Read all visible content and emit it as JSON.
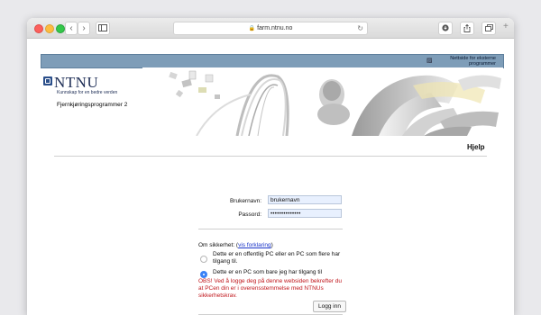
{
  "browser": {
    "url": "farm.ntnu.no",
    "back_glyph": "‹",
    "forward_glyph": "›",
    "new_tab_glyph": "+"
  },
  "header": {
    "external_link": "Nettside for eksterne programmer",
    "logo_text": "NTNU",
    "logo_tagline": "Kunnskap for en bedre verden",
    "system_name": "Fjernkjøringsprogrammer 2",
    "help": "Hjelp"
  },
  "login": {
    "username_label": "Brukernavn:",
    "username_value": "brukernavn",
    "password_label": "Passord:",
    "password_value": "••••••••••••••",
    "security_label": "Om sikkerhet:",
    "security_link": "vis forklaring",
    "option_public": "Dette er en offentlig PC eller en PC som flere har tilgang til.",
    "option_private": "Dette er en PC som bare jeg har tilgang til",
    "selected_option": "private",
    "warning": "OBS! Ved å logge deg på denne websiden bekrefter du at PCen din er i overensstemmelse med NTNUs sikkerhetskrav.",
    "submit": "Logg inn"
  },
  "colors": {
    "header_bar": "#7e9db8",
    "warning": "#c0161b",
    "link": "#1a35c8"
  }
}
